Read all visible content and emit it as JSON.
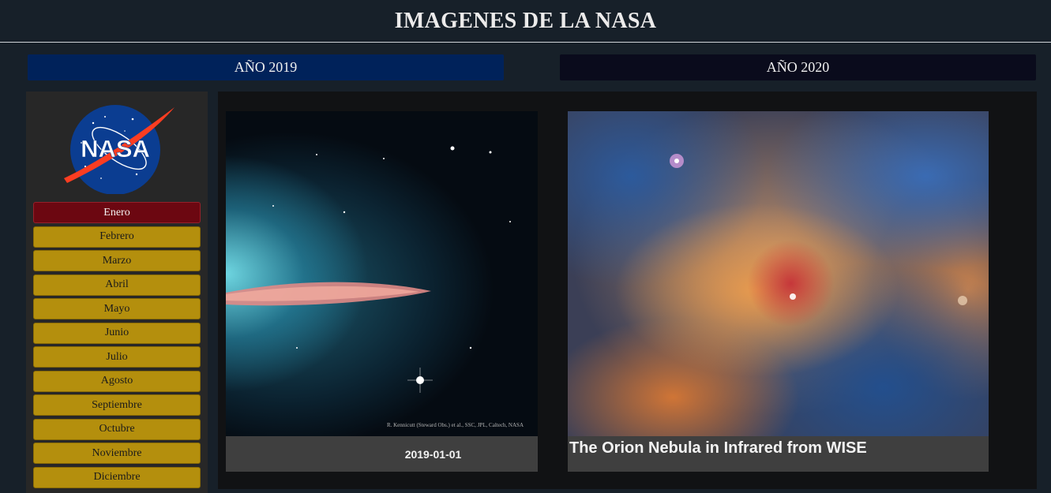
{
  "header": {
    "title": "IMAGENES DE LA NASA"
  },
  "years": [
    {
      "label": "AÑO 2019",
      "color": "#00225a"
    },
    {
      "label": "AÑO 2020",
      "color": "#0a0b1c"
    }
  ],
  "sidebar": {
    "logo_text": "NASA",
    "months": [
      "Enero",
      "Febrero",
      "Marzo",
      "Abril",
      "Mayo",
      "Junio",
      "Julio",
      "Agosto",
      "Septiembre",
      "Octubre",
      "Noviembre",
      "Diciembre"
    ],
    "active_month": "Enero",
    "month_color": "#b48f0d",
    "active_color": "#6c0711"
  },
  "cards": [
    {
      "caption": "2019-01-01",
      "credit": "R. Kennicutt (Steward Obs.) et al., SSC, JPL, Caltech, NASA"
    },
    {
      "caption": "The Orion Nebula in Infrared from WISE"
    }
  ]
}
